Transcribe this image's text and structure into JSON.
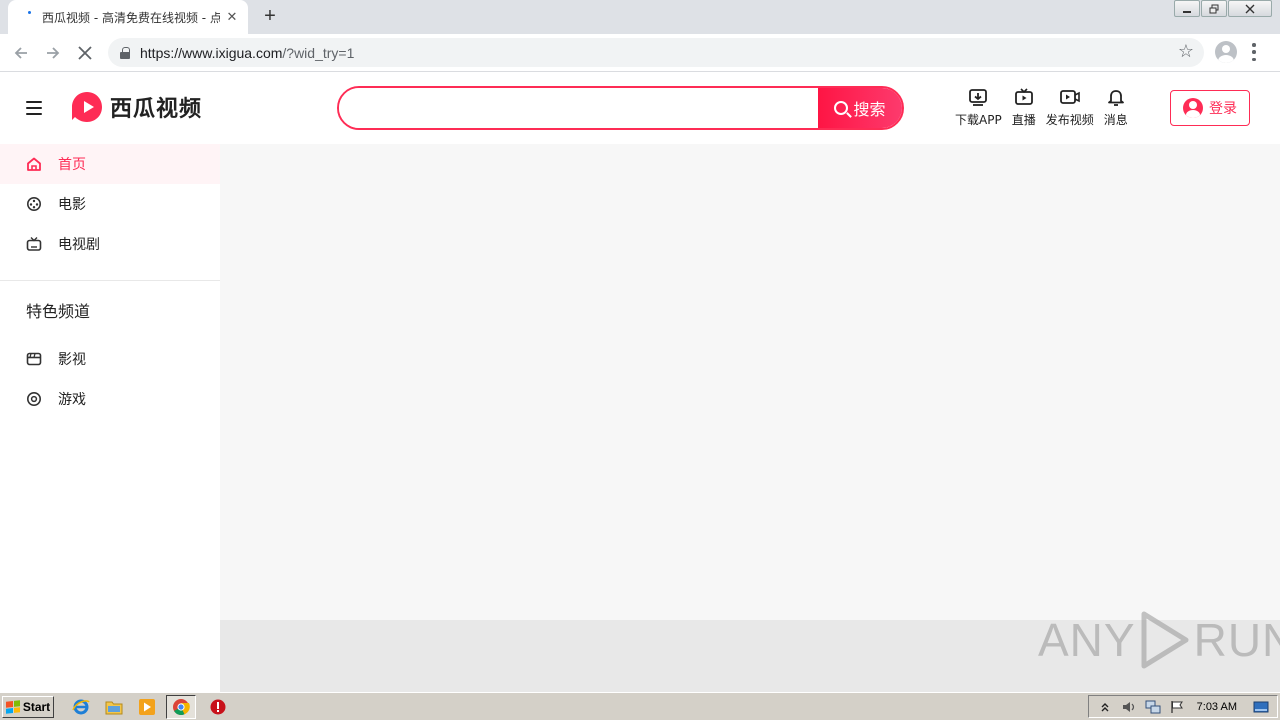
{
  "browser": {
    "tab_title": "西瓜视频 - 高清免费在线视频 - 点亮",
    "tab_close": "✕",
    "new_tab": "+",
    "url_host": "https://www.ixigua.com",
    "url_rest": "/?wid_try=1"
  },
  "site": {
    "logo_text": "西瓜视频",
    "search": {
      "placeholder": "",
      "value": "",
      "button_label": "搜索"
    },
    "header_actions": [
      {
        "label": "下载APP",
        "icon": "download-app-icon"
      },
      {
        "label": "直播",
        "icon": "live-tv-icon"
      },
      {
        "label": "发布视频",
        "icon": "upload-video-icon"
      },
      {
        "label": "消息",
        "icon": "bell-icon"
      }
    ],
    "login_label": "登录",
    "brand_color": "#fe2c55"
  },
  "sidebar": {
    "items": [
      {
        "label": "首页",
        "icon": "home-icon",
        "active": true
      },
      {
        "label": "电影",
        "icon": "film-reel-icon"
      },
      {
        "label": "电视剧",
        "icon": "tv-icon"
      }
    ],
    "section_title": "特色频道",
    "channels": [
      {
        "label": "影视",
        "icon": "clapperboard-icon"
      },
      {
        "label": "游戏",
        "icon": "gamepad-icon"
      }
    ]
  },
  "watermark": {
    "left": "ANY",
    "right": "RUN"
  },
  "taskbar": {
    "start_label": "Start",
    "clock": "7:03 AM"
  }
}
